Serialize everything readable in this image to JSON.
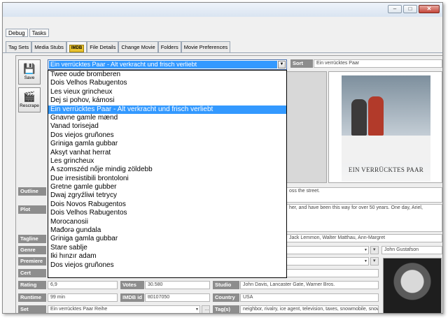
{
  "window": {
    "minimize": "–",
    "maximize": "□",
    "close": "✕"
  },
  "menu": [
    "Debug",
    "Tasks"
  ],
  "tabs": [
    "Tag Sets",
    "Media Stubs",
    "IMDB",
    "File Details",
    "Change Movie",
    "Folders",
    "Movie Preferences"
  ],
  "side_buttons": {
    "save": "Save",
    "rescrape": "Rescrape"
  },
  "title_combo": {
    "value": "Ein verrücktes Paar - Alt verkracht und frisch verliebt",
    "options": [
      "Twee oude bromberen",
      "Dois Velhos Rabugentos",
      "Les vieux grincheux",
      "Dej si pohov, kámosi",
      "Ein verrücktes Paar - Alt verkracht und frisch verliebt",
      "Gnavne gamle mænd",
      "Vanad torisejad",
      "Dos viejos gruñones",
      "Griniga gamla gubbar",
      "Aksyt vanhat herrat",
      "Les grincheux",
      "A szomszéd nője mindig zöldebb",
      "Due irresistibili brontoloni",
      "Gretne gamle gubber",
      "Dwaj zgryźliwi tetrycy",
      "Dois Novos Rabugentos",
      "Dois Velhos Rabugentos",
      "Morocanosii",
      "Mađorə gundala",
      "Griniga gamla gubbar",
      "Stare sablje",
      "Iki hınzır adam",
      "Dos viejos gruñones"
    ]
  },
  "sort": {
    "label": "Sort",
    "value": "Ein verrücktes Paar"
  },
  "poster_title": "EIN VERRÜCKTES PAAR",
  "outline": {
    "label": "Outline",
    "value": "oss the street."
  },
  "plot": {
    "label": "Plot",
    "value": "her, and have been this way for over 50 years. One day, Ariel,"
  },
  "tagline": {
    "label": "Tagline"
  },
  "actors_text": "Jack Lemmon, Walter Matthau, Ann-Margret",
  "genre": {
    "label": "Genre"
  },
  "premiere": {
    "label": "Premiere"
  },
  "cert": {
    "label": "Cert"
  },
  "director": "John Gustafson",
  "rating": {
    "label": "Rating",
    "value": "6,9"
  },
  "votes": {
    "label": "Votes",
    "value": "30.580"
  },
  "studio": {
    "label": "Studio",
    "value": "John Davis, Lancaster Gate, Warner Bros."
  },
  "runtime": {
    "label": "Runtime",
    "value": "99 min"
  },
  "imdb_id": {
    "label": "IMDB id",
    "value": "tt0107050"
  },
  "country": {
    "label": "Country",
    "value": "USA"
  },
  "set": {
    "label": "Set",
    "value": "Ein verrücktes Paar Reihe"
  },
  "tags": {
    "label": "Tag(s)",
    "value": "neighbor, rivalry, ice agent, television, taxes, snowmobile, snow an"
  }
}
